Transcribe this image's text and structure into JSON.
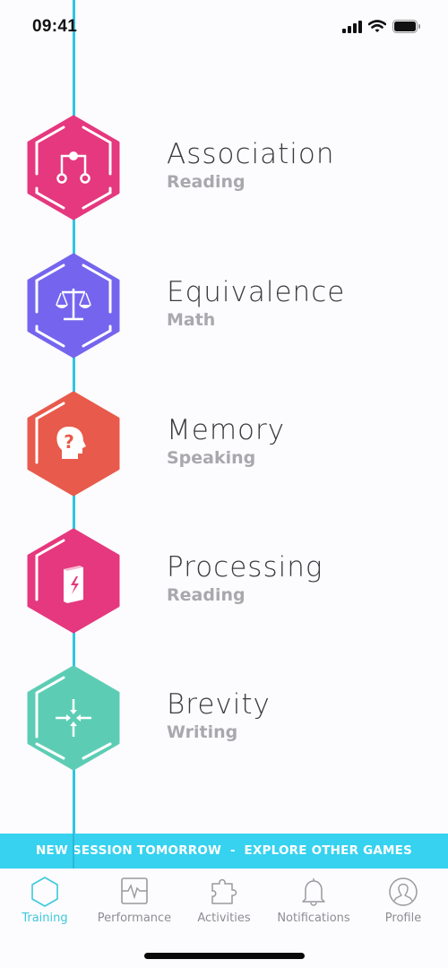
{
  "status_bar": {
    "time": "09:41",
    "icons": [
      "cellular-signal-icon",
      "wifi-icon",
      "battery-icon"
    ]
  },
  "timeline_color": "#2ec6e3",
  "games": [
    {
      "title": "Association",
      "subtitle": "Reading",
      "icon": "branch-nodes-icon",
      "color": "#e5387e"
    },
    {
      "title": "Equivalence",
      "subtitle": "Math",
      "icon": "balance-scale-icon",
      "color": "#7565ee"
    },
    {
      "title": "Memory",
      "subtitle": "Speaking",
      "icon": "head-question-icon",
      "color": "#e85a4b"
    },
    {
      "title": "Processing",
      "subtitle": "Reading",
      "icon": "book-lightning-icon",
      "color": "#e5387e"
    },
    {
      "title": "Brevity",
      "subtitle": "Writing",
      "icon": "arrows-inward-icon",
      "color": "#5ccdb4"
    }
  ],
  "banner": {
    "text": "NEW SESSION TOMORROW  -  EXPLORE OTHER GAMES",
    "color": "#36d2ef"
  },
  "tabbar": {
    "active_color": "#3ec9db",
    "tabs": [
      {
        "label": "Training",
        "icon": "hexagon-icon",
        "active": true
      },
      {
        "label": "Performance",
        "icon": "pulse-chart-icon",
        "active": false
      },
      {
        "label": "Activities",
        "icon": "puzzle-icon",
        "active": false
      },
      {
        "label": "Notifications",
        "icon": "bell-icon",
        "active": false
      },
      {
        "label": "Profile",
        "icon": "profile-icon",
        "active": false
      }
    ]
  }
}
